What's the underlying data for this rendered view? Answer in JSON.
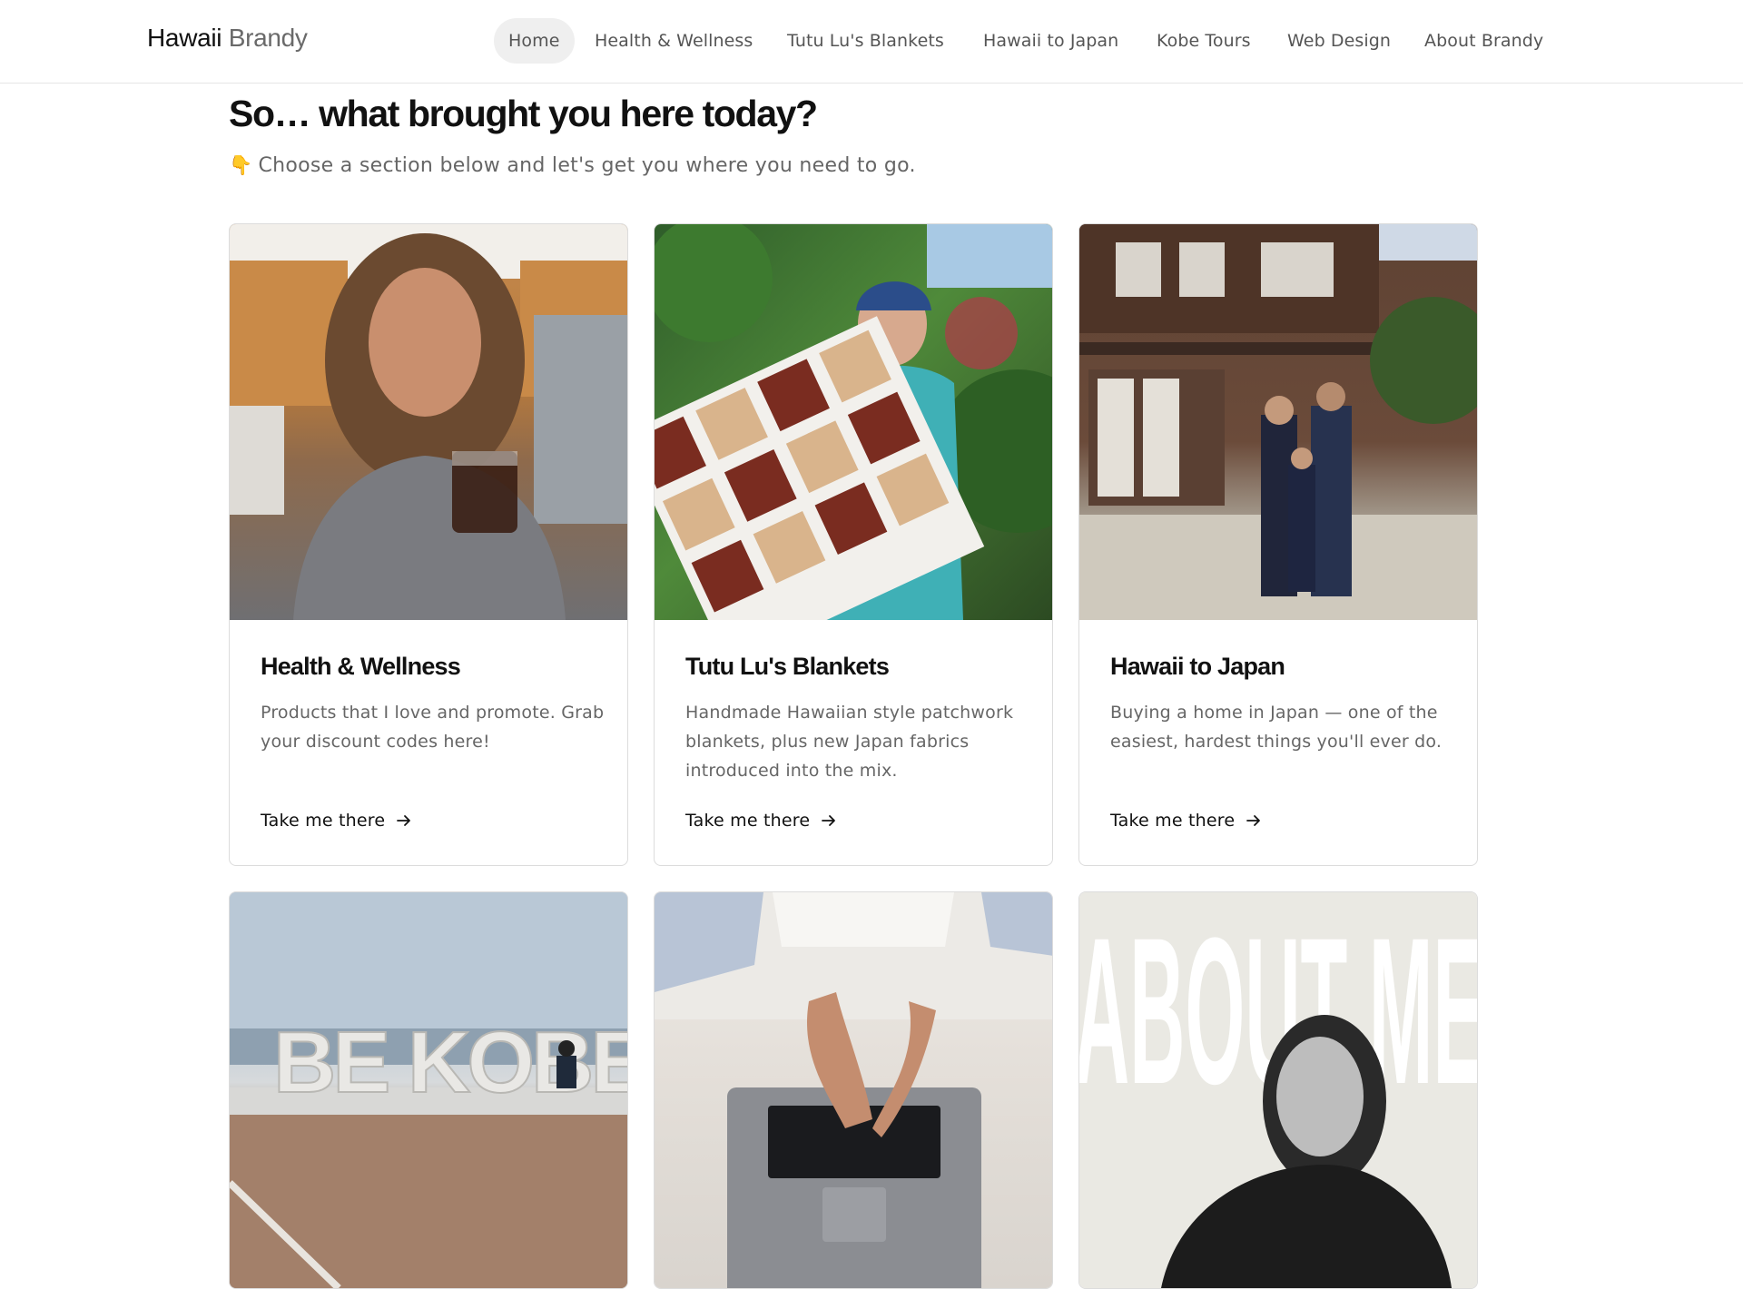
{
  "header": {
    "brand_first": "Hawaii",
    "brand_second": "Brandy",
    "nav": [
      {
        "label": "Home"
      },
      {
        "label": "Health & Wellness"
      },
      {
        "label": "Tutu Lu's Blankets"
      },
      {
        "label": "Hawaii to Japan"
      },
      {
        "label": "Kobe Tours"
      },
      {
        "label": "Web Design"
      },
      {
        "label": "About Brandy"
      }
    ]
  },
  "main": {
    "heading": "So… what brought you here today?",
    "subheading_icon": "👇",
    "subheading": "Choose a section below and let's get you where you need to go.",
    "cards": [
      {
        "title": "Health & Wellness",
        "description": "Products that I love and promote. Grab your discount codes here!",
        "cta": "Take me there"
      },
      {
        "title": "Tutu Lu's Blankets",
        "description": "Handmade Hawaiian style patchwork blankets, plus new Japan fabrics introduced into the mix.",
        "cta": "Take me there"
      },
      {
        "title": "Hawaii to Japan",
        "description": "Buying a home in Japan — one of the easiest, hardest things you'll ever do.",
        "cta": "Take me there"
      }
    ],
    "about_image_text": "ABOUT ME",
    "kobe_sign_text": "BE KOBE"
  },
  "colors": {
    "nav_active_bg": "#efefef",
    "muted_text": "#666666",
    "border": "#dcdcdc"
  }
}
